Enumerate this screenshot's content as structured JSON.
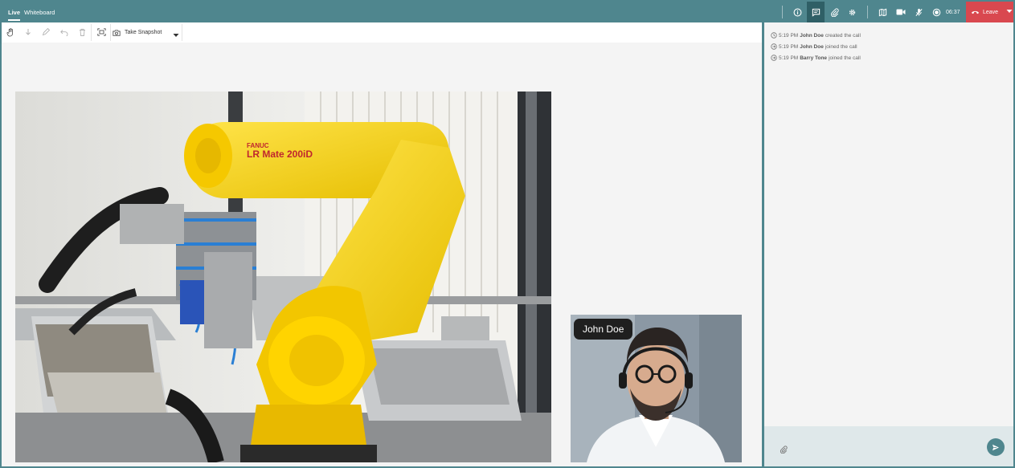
{
  "topbar": {
    "tabs": [
      {
        "label": "Live",
        "active": true
      },
      {
        "label": "Whiteboard",
        "active": false
      }
    ],
    "icons": [
      "info-icon",
      "chat-icon",
      "attachment-icon",
      "settings-icon",
      "map-icon",
      "camera-icon",
      "mic-off-icon",
      "record-icon"
    ],
    "active_icon": "chat-icon",
    "timer": "06:37",
    "leave_label": "Leave",
    "colors": {
      "bar": "#4f868e",
      "active": "#2f5f66",
      "leave": "#d9484f"
    }
  },
  "toolbar": {
    "tools": [
      "hand-icon",
      "arrow-down-icon",
      "pen-icon",
      "undo-icon",
      "trash-icon",
      "screen-capture-icon"
    ],
    "snapshot_label": "Take Snapshot"
  },
  "stage": {
    "participant_name": "John Doe"
  },
  "chat": {
    "events": [
      {
        "time": "5:19 PM",
        "name": "John Doe",
        "action": "created the call"
      },
      {
        "time": "5:19 PM",
        "name": "John Doe",
        "action": "joined the call"
      },
      {
        "time": "5:19 PM",
        "name": "Barry Tone",
        "action": "joined the call"
      }
    ]
  }
}
